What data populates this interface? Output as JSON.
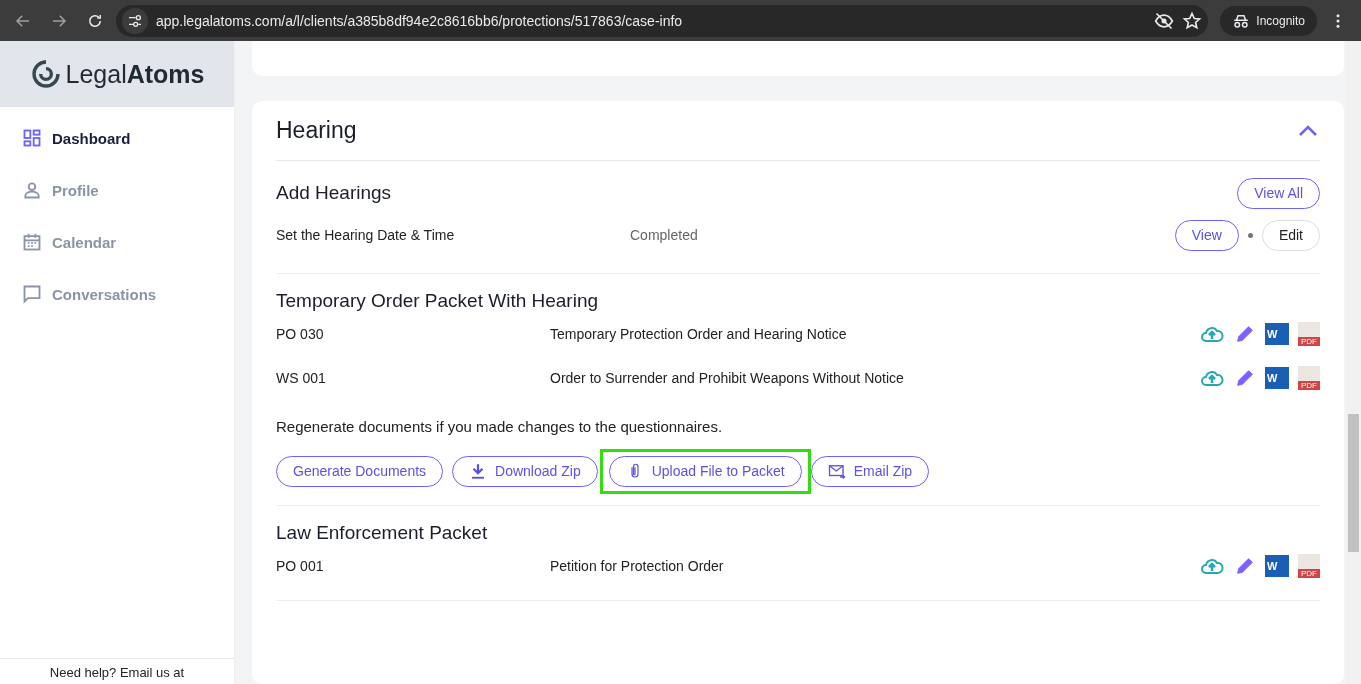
{
  "browser": {
    "url": "app.legalatoms.com/a/l/clients/a385b8df94e2c8616bb6/protections/517863/case-info",
    "profile": "Incognito"
  },
  "sidebar": {
    "logo": {
      "light": "Legal",
      "bold": "Atoms"
    },
    "items": [
      {
        "label": "Dashboard",
        "kind": "dashboard",
        "selected": true
      },
      {
        "label": "Profile",
        "kind": "person",
        "selected": false
      },
      {
        "label": "Calendar",
        "kind": "calendar",
        "selected": false
      },
      {
        "label": "Conversations",
        "kind": "chat",
        "selected": false
      }
    ],
    "help_text": "Need help? Email us at"
  },
  "section": {
    "title": "Hearing",
    "expanded": true,
    "hearings": {
      "title": "Add Hearings",
      "view_all": "View All",
      "rows": [
        {
          "name": "Set the Hearing Date & Time",
          "status": "Completed",
          "view": "View",
          "edit": "Edit"
        }
      ]
    },
    "packets": [
      {
        "title": "Temporary Order Packet With Hearing",
        "documents": [
          {
            "code": "PO 030",
            "name": "Temporary Protection Order and Hearing Notice",
            "word_icon_text": "W",
            "pdf_icon_text": "PDF"
          },
          {
            "code": "WS 001",
            "name": "Order to Surrender and Prohibit Weapons Without Notice",
            "word_icon_text": "W",
            "pdf_icon_text": "PDF"
          }
        ],
        "note": "Regenerate documents if you made changes to the questionnaires.",
        "actions": [
          {
            "label": "Generate Documents",
            "kind": "plain",
            "highlighted": false
          },
          {
            "label": "Download Zip",
            "kind": "download",
            "highlighted": false
          },
          {
            "label": "Upload File to Packet",
            "kind": "attach",
            "highlighted": true
          },
          {
            "label": "Email Zip",
            "kind": "email",
            "highlighted": false
          }
        ]
      },
      {
        "title": "Law Enforcement Packet",
        "documents": [
          {
            "code": "PO 001",
            "name": "Petition for Protection Order",
            "word_icon_text": "W",
            "pdf_icon_text": "PDF"
          }
        ]
      }
    ]
  }
}
